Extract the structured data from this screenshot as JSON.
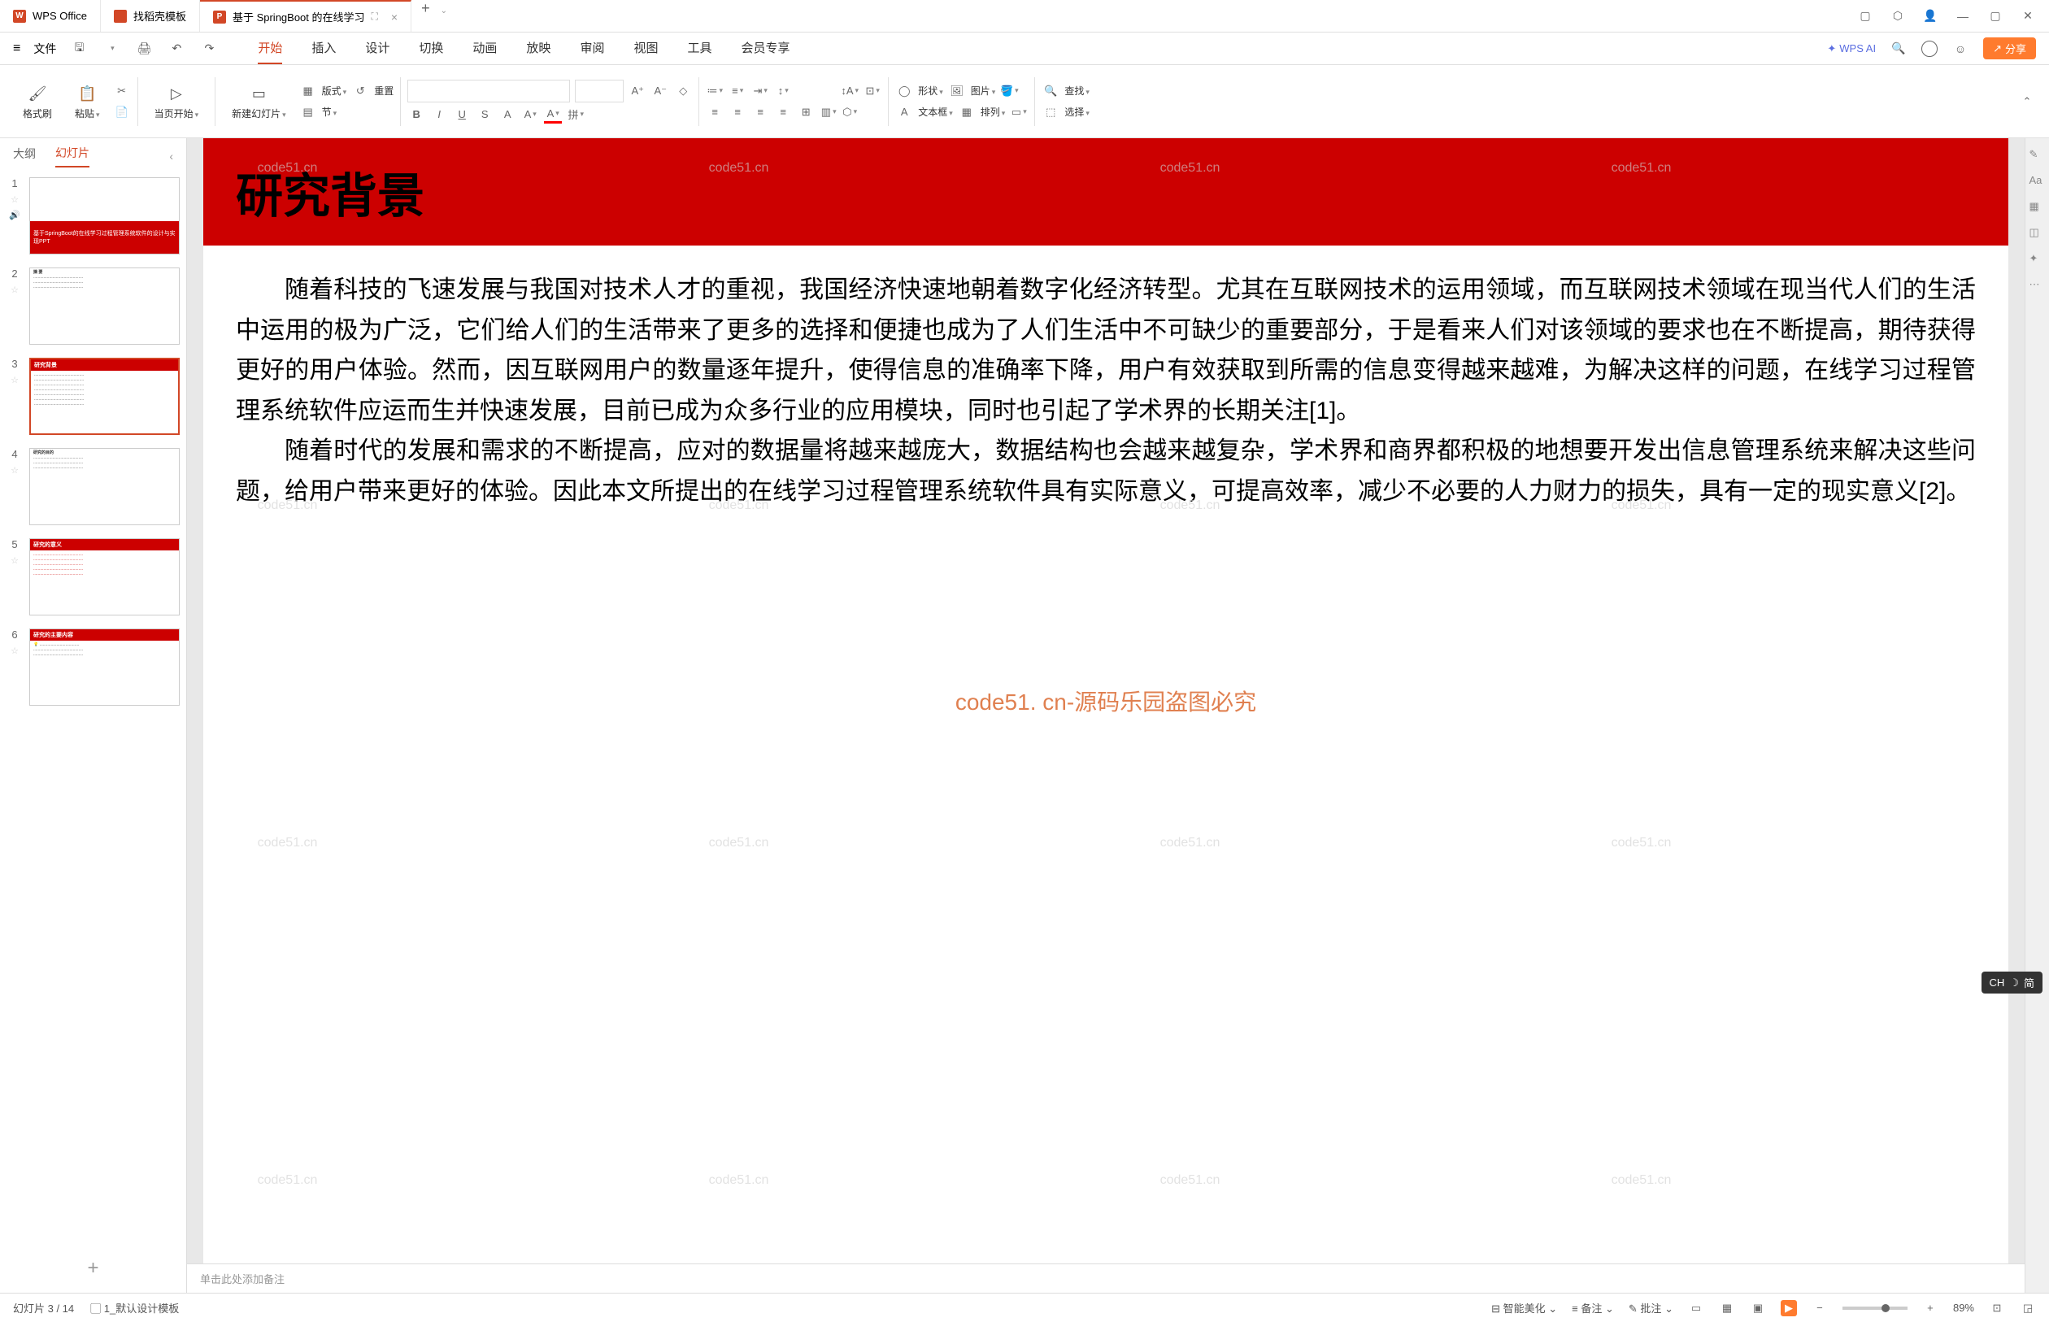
{
  "titlebar": {
    "tabs": [
      {
        "label": "WPS Office",
        "type": "wps"
      },
      {
        "label": "找稻壳模板",
        "type": "docer"
      },
      {
        "label": "基于 SpringBoot 的在线学习",
        "type": "ppt",
        "active": true
      }
    ],
    "add": "+"
  },
  "menubar": {
    "file": "文件",
    "tabs": [
      "开始",
      "插入",
      "设计",
      "切换",
      "动画",
      "放映",
      "审阅",
      "视图",
      "工具",
      "会员专享"
    ],
    "active_tab": "开始",
    "wps_ai": "WPS AI",
    "share": "分享"
  },
  "ribbon": {
    "format_brush": "格式刷",
    "paste": "粘贴",
    "from_current": "当页开始",
    "new_slide": "新建幻灯片",
    "layout": "版式",
    "section": "节",
    "reset": "重置",
    "shape": "形状",
    "picture": "图片",
    "textbox": "文本框",
    "arrange": "排列",
    "find": "查找",
    "select": "选择"
  },
  "sidebar": {
    "tabs": [
      "大纲",
      "幻灯片"
    ],
    "active": "幻灯片",
    "slides": [
      {
        "num": "1",
        "title": "基于SpringBoot的在线学习过程管理系统软件的设计与实现PPT"
      },
      {
        "num": "2",
        "title": "摘 要"
      },
      {
        "num": "3",
        "title": "研究背景",
        "selected": true
      },
      {
        "num": "4",
        "title": "研究的目的"
      },
      {
        "num": "5",
        "title": "研究的意义"
      },
      {
        "num": "6",
        "title": "研究的主要内容"
      }
    ],
    "add": "+"
  },
  "slide": {
    "title": "研究背景",
    "para1": "随着科技的飞速发展与我国对技术人才的重视，我国经济快速地朝着数字化经济转型。尤其在互联网技术的运用领域，而互联网技术领域在现当代人们的生活中运用的极为广泛，它们给人们的生活带来了更多的选择和便捷也成为了人们生活中不可缺少的重要部分，于是看来人们对该领域的要求也在不断提高，期待获得更好的用户体验。然而，因互联网用户的数量逐年提升，使得信息的准确率下降，用户有效获取到所需的信息变得越来越难，为解决这样的问题，在线学习过程管理系统软件应运而生并快速发展，目前已成为众多行业的应用模块，同时也引起了学术界的长期关注[1]。",
    "para2": "随着时代的发展和需求的不断提高，应对的数据量将越来越庞大，数据结构也会越来越复杂，学术界和商界都积极的地想要开发出信息管理系统来解决这些问题，给用户带来更好的体验。因此本文所提出的在线学习过程管理系统软件具有实际意义，可提高效率，减少不必要的人力财力的损失，具有一定的现实意义[2]。",
    "watermark_center": "code51. cn-源码乐园盗图必究",
    "watermark_small": "code51.cn"
  },
  "notes": {
    "placeholder": "单击此处添加备注"
  },
  "statusbar": {
    "slide_pos": "幻灯片 3 / 14",
    "template": "1_默认设计模板",
    "beautify": "智能美化",
    "notes_btn": "备注",
    "comments": "批注",
    "zoom": "89%"
  },
  "ime": {
    "lang": "CH",
    "mode": "简"
  }
}
